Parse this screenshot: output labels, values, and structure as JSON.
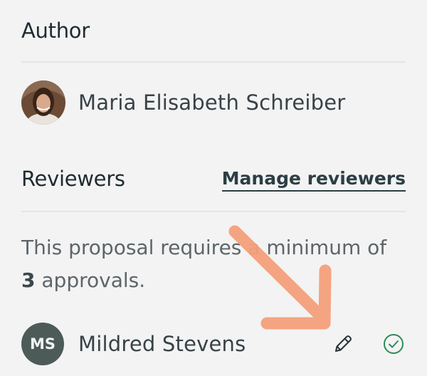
{
  "author": {
    "title": "Author",
    "name": "Maria Elisabeth Schreiber"
  },
  "reviewers": {
    "title": "Reviewers",
    "manage_label": "Manage reviewers",
    "requirement_prefix": "This proposal requires a minimum of ",
    "min_approvals": "3",
    "requirement_suffix": " approvals.",
    "list": [
      {
        "initials": "MS",
        "name": "Mildred Stevens",
        "status": "approved"
      }
    ]
  },
  "icons": {
    "edit": "pencil-icon",
    "approved": "check-circle-icon",
    "annotation": "arrow-annotation"
  },
  "colors": {
    "background": "#f3f3f3",
    "avatar_bg": "#4c5b58",
    "approved": "#2e8b57",
    "arrow": "#f5a07a"
  }
}
